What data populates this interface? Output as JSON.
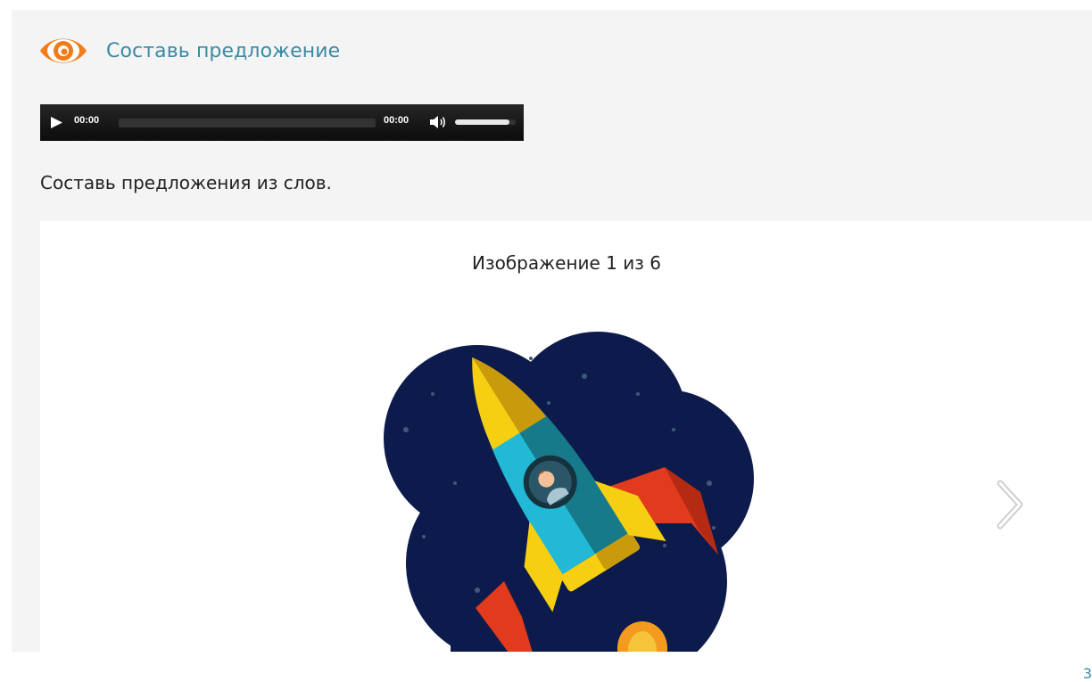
{
  "activity": {
    "title": "Составь предложение",
    "icon": "eye-icon",
    "accent_color": "#f27b1a",
    "title_color": "#3a8aa3"
  },
  "audio_player": {
    "current_time": "00:00",
    "duration": "00:00",
    "progress": 0,
    "volume": 0.9
  },
  "instruction": "Составь предложения из слов.",
  "viewer": {
    "counter_text": "Изображение 1 из 6",
    "next_icon": "chevron-right-icon"
  },
  "corner_number": "3"
}
